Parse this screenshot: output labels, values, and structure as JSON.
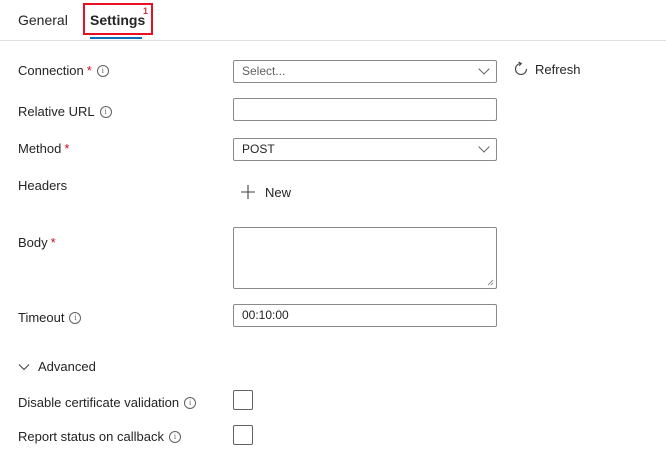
{
  "tabs": [
    {
      "label": "General",
      "active": false
    },
    {
      "label": "Settings",
      "active": true,
      "badge": "1"
    }
  ],
  "form": {
    "connection": {
      "label": "Connection",
      "required": "*",
      "placeholder": "Select..."
    },
    "refresh_label": "Refresh",
    "relative_url": {
      "label": "Relative URL",
      "value": ""
    },
    "method": {
      "label": "Method",
      "required": "*",
      "value": "POST"
    },
    "headers": {
      "label": "Headers",
      "new_label": "New"
    },
    "body": {
      "label": "Body",
      "required": "*",
      "value": ""
    },
    "timeout": {
      "label": "Timeout",
      "value": "00:10:00"
    },
    "advanced_label": "Advanced",
    "disable_cert": {
      "label": "Disable certificate validation",
      "checked": false
    },
    "report_status": {
      "label": "Report status on callback",
      "checked": false
    }
  },
  "colors": {
    "accent": "#0f6cbd",
    "highlight": "#e81123",
    "required": "#c50f1f"
  },
  "icons": {
    "info": "info-icon",
    "refresh": "refresh-icon",
    "add": "plus-icon",
    "expand": "chevron-down-icon"
  }
}
